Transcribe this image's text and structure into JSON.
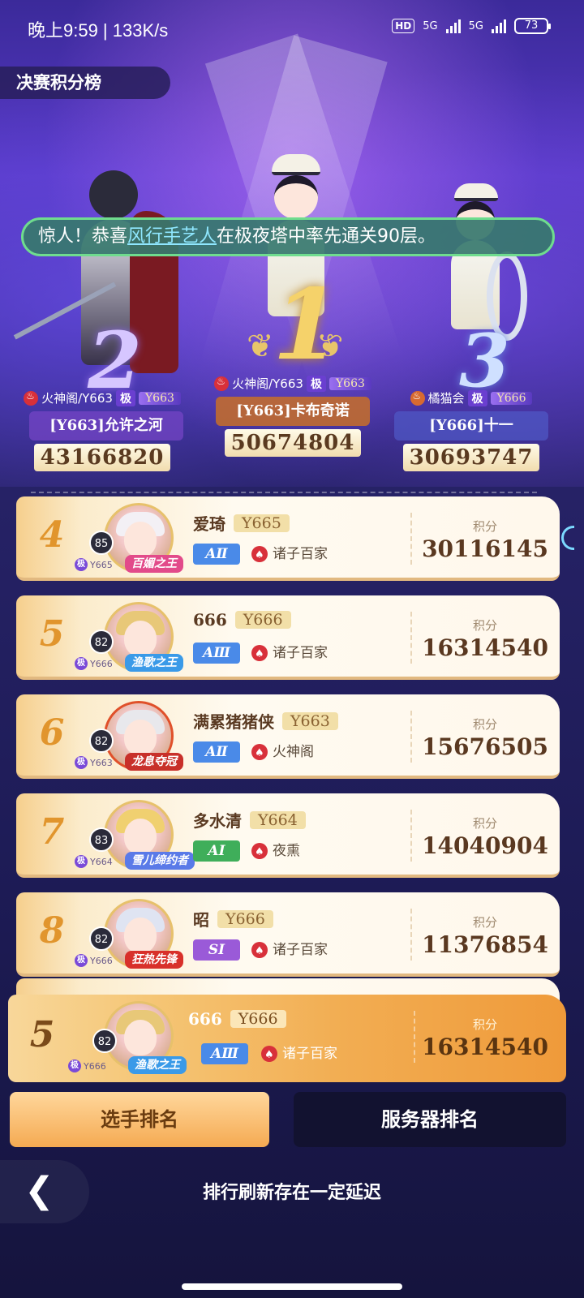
{
  "status_bar": {
    "time": "晚上9:59 | 133K/s",
    "hd": "HD",
    "net1": "5G",
    "net2": "5G",
    "battery": "73"
  },
  "page_title": "决赛积分榜",
  "marquee": {
    "prefix": "惊人！恭喜",
    "highlight": "风行手艺人",
    "suffix": "在极夜塔中率先通关90层。"
  },
  "podium": [
    {
      "rank": "1",
      "guild": "火神阁/Y663",
      "ji": "极",
      "server": "Y663",
      "name": "[Y663]卡布奇诺",
      "score": "50674804"
    },
    {
      "rank": "2",
      "guild": "火神阁/Y663",
      "ji": "极",
      "server": "Y663",
      "name": "[Y663]允许之河",
      "score": "43166820"
    },
    {
      "rank": "3",
      "guild": "橘猫会",
      "ji": "极",
      "server": "Y666",
      "name": "[Y666]十一",
      "score": "30693747"
    }
  ],
  "rows": [
    {
      "rank": "4",
      "level": "85",
      "ji": "极",
      "ji_server": "Y665",
      "title": "百媚之王",
      "name": "爱琦",
      "server": "Y665",
      "tier": "AⅡ",
      "guild": "诸子百家",
      "score_label": "积分",
      "score": "30116145"
    },
    {
      "rank": "5",
      "level": "82",
      "ji": "极",
      "ji_server": "Y666",
      "title": "渔歌之王",
      "name": "666",
      "server": "Y666",
      "tier": "AⅢ",
      "guild": "诸子百家",
      "score_label": "积分",
      "score": "16314540"
    },
    {
      "rank": "6",
      "level": "82",
      "ji": "极",
      "ji_server": "Y663",
      "title": "龙息夺冠",
      "name": "满累猪猪侠",
      "server": "Y663",
      "tier": "AⅡ",
      "guild": "火神阁",
      "score_label": "积分",
      "score": "15676505"
    },
    {
      "rank": "7",
      "level": "83",
      "ji": "极",
      "ji_server": "Y664",
      "title": "雪儿缔约者",
      "name": "多水清",
      "server": "Y664",
      "tier": "AⅠ",
      "guild": "夜熏",
      "score_label": "积分",
      "score": "14040904"
    },
    {
      "rank": "8",
      "level": "82",
      "ji": "极",
      "ji_server": "Y666",
      "title": "狂热先锋",
      "name": "昭",
      "server": "Y666",
      "tier": "SⅠ",
      "guild": "诸子百家",
      "score_label": "积分",
      "score": "11376854"
    }
  ],
  "my_rank": {
    "rank": "5",
    "level": "82",
    "ji": "极",
    "ji_server": "Y666",
    "title": "渔歌之王",
    "name": "666",
    "server": "Y666",
    "tier": "AⅢ",
    "guild": "诸子百家",
    "score_label": "积分",
    "score": "16314540"
  },
  "tabs": {
    "player": "选手排名",
    "server": "服务器排名"
  },
  "footer_note": "排行刷新存在一定延迟",
  "colors": {
    "tier_a": "#4a8ae8",
    "tier_a1": "#3fae5a",
    "tier_s": "#9a5ad8",
    "accent_orange": "#e1952d"
  }
}
